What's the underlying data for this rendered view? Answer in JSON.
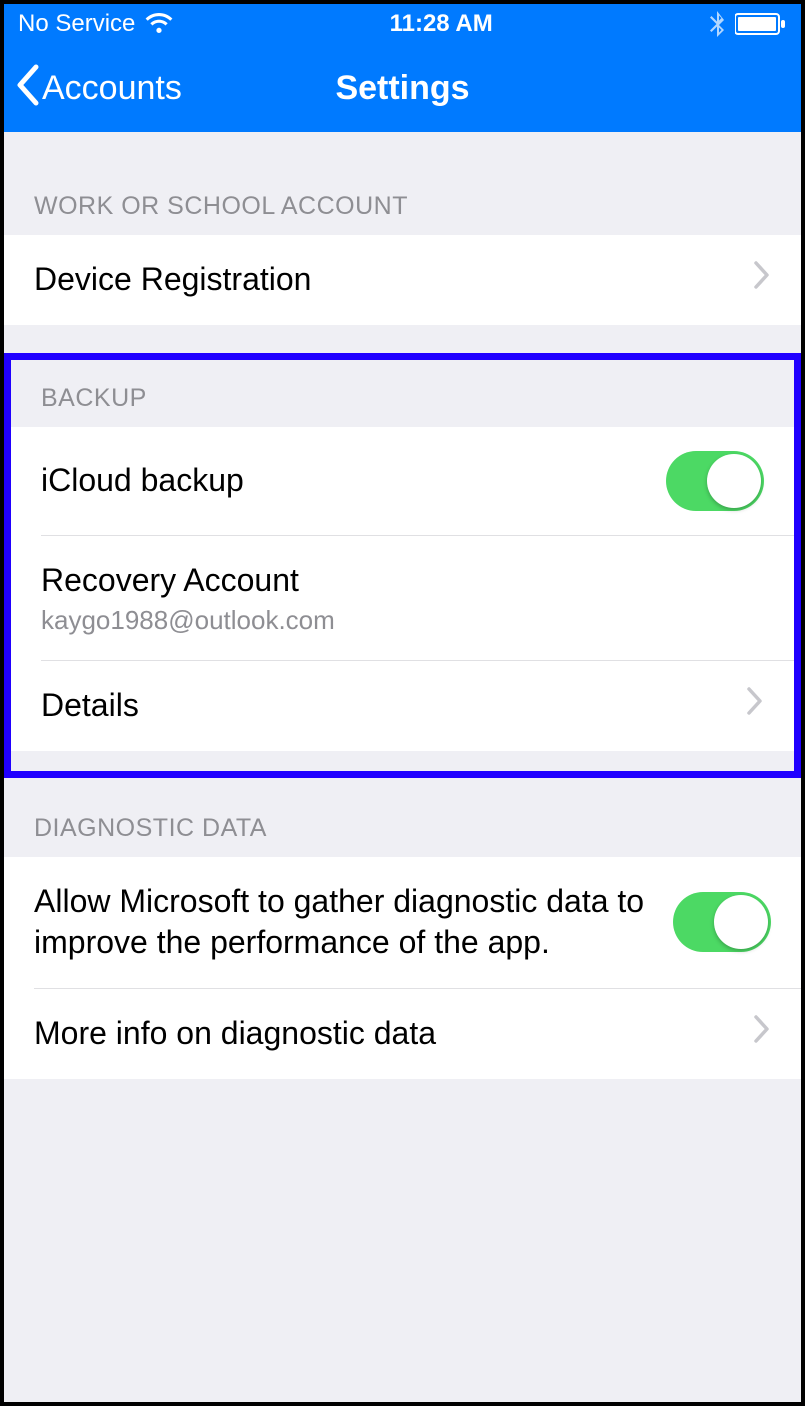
{
  "status_bar": {
    "service": "No Service",
    "time": "11:28 AM"
  },
  "nav": {
    "back_label": "Accounts",
    "title": "Settings"
  },
  "sections": {
    "work_school": {
      "header": "WORK OR SCHOOL ACCOUNT",
      "device_registration": "Device Registration"
    },
    "backup": {
      "header": "BACKUP",
      "icloud_backup": "iCloud backup",
      "icloud_backup_on": true,
      "recovery_account_label": "Recovery Account",
      "recovery_account_email": "kaygo1988@outlook.com",
      "details": "Details"
    },
    "diagnostic": {
      "header": "DIAGNOSTIC DATA",
      "allow_text": "Allow Microsoft to gather diagnostic data to improve the performance of the app.",
      "allow_on": true,
      "more_info": "More info on diagnostic data"
    }
  }
}
